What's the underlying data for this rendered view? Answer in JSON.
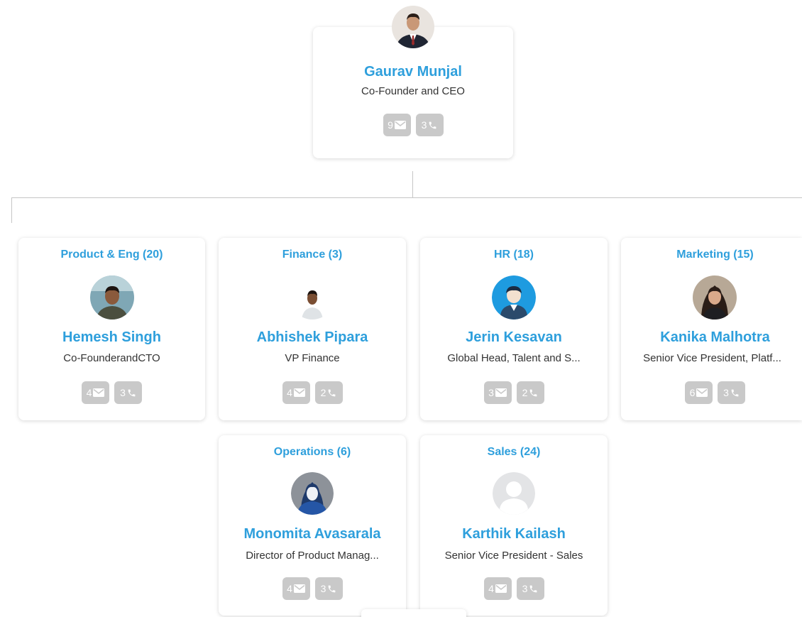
{
  "root": {
    "name": "Gaurav Munjal",
    "title": "Co-Founder and CEO",
    "email_count": "9",
    "phone_count": "3",
    "avatar": "person-photo-suit-icon"
  },
  "departments": [
    {
      "dept": "Product & Eng (20)",
      "name": "Hemesh Singh",
      "title": "Co-FounderandCTO",
      "email_count": "4",
      "phone_count": "3",
      "avatar": "person-photo-icon"
    },
    {
      "dept": "Finance (3)",
      "name": "Abhishek Pipara",
      "title": "VP Finance",
      "email_count": "4",
      "phone_count": "2",
      "avatar": "person-photo-icon"
    },
    {
      "dept": "HR (18)",
      "name": "Jerin Kesavan",
      "title": "Global Head, Talent and S...",
      "email_count": "3",
      "phone_count": "2",
      "avatar": "male-placeholder-icon"
    },
    {
      "dept": "Marketing (15)",
      "name": "Kanika Malhotra",
      "title": "Senior Vice President, Platf...",
      "email_count": "6",
      "phone_count": "3",
      "avatar": "person-photo-icon"
    },
    {
      "dept": "Operations (6)",
      "name": "Monomita Avasarala",
      "title": "Director of Product Manag...",
      "email_count": "4",
      "phone_count": "3",
      "avatar": "female-placeholder-icon"
    },
    {
      "dept": "Sales (24)",
      "name": "Karthik Kailash",
      "title": "Senior Vice President - Sales",
      "email_count": "4",
      "phone_count": "3",
      "avatar": "default-user-icon"
    }
  ],
  "colors": {
    "accent": "#2e9fdc",
    "badge": "#c9c9c9",
    "connector": "#c6c6c6"
  }
}
